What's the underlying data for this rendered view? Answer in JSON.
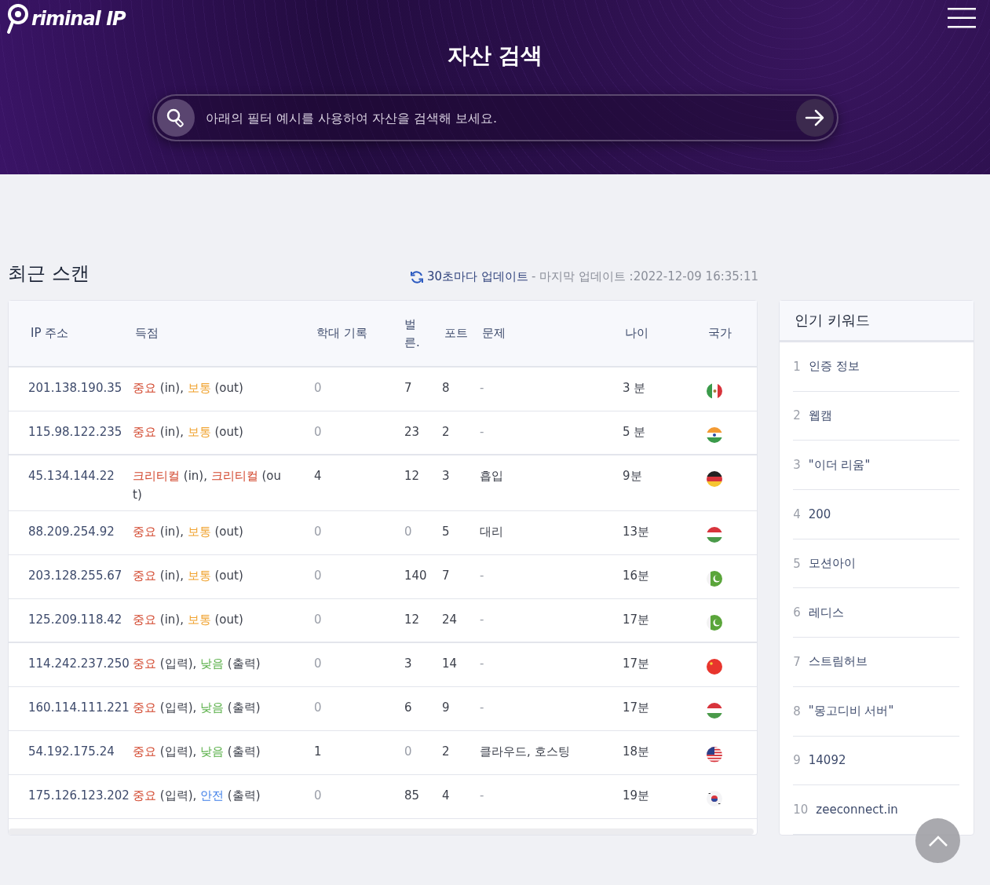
{
  "header": {
    "logo": "riminal IP",
    "title": "자산 검색",
    "search": {
      "placeholder": "아래의 필터 예시를 사용하여 자산을 검색해 보세요."
    }
  },
  "recent": {
    "title": "최근 스캔",
    "update_link": "30초마다 업데이트",
    "update_info": "- 마지막 업데이트 :2022-12-09 16:35:11",
    "columns": [
      "IP 주소",
      "득점",
      "학대 기록",
      "벌른.",
      "포트",
      "문제",
      "나이",
      "국가"
    ],
    "rows": [
      {
        "ip": "201.138.190.35",
        "score": [
          {
            "kind": "high",
            "level": "중요",
            "label": "(in),"
          },
          {
            "kind": "medium",
            "level": "보통",
            "label": "(out)"
          }
        ],
        "abuse": "0",
        "abuse_muted": true,
        "vuln": "7",
        "vuln_muted": false,
        "port": "8",
        "issue": "-",
        "issue_muted": true,
        "age": "3 분",
        "flag": {
          "kind": "mx"
        }
      },
      {
        "ip": "115.98.122.235",
        "score": [
          {
            "kind": "high",
            "level": "중요",
            "label": "(in),"
          },
          {
            "kind": "medium",
            "level": "보통",
            "label": "(out)"
          }
        ],
        "abuse": "0",
        "abuse_muted": true,
        "vuln": "23",
        "vuln_muted": false,
        "port": "2",
        "issue": "-",
        "issue_muted": true,
        "age": "5 분",
        "flag": {
          "kind": "in"
        }
      },
      {
        "ip": "45.134.144.22",
        "score": [
          {
            "kind": "critical",
            "level": "크리티컬",
            "label": "(in),"
          },
          {
            "kind": "critical",
            "level": "크리티컬",
            "label": "(out)"
          }
        ],
        "abuse": "4",
        "abuse_muted": false,
        "vuln": "12",
        "vuln_muted": false,
        "port": "3",
        "issue": "흡입",
        "issue_muted": false,
        "age": "9분",
        "flag": {
          "kind": "de"
        }
      },
      {
        "ip": "88.209.254.92",
        "score": [
          {
            "kind": "high",
            "level": "중요",
            "label": "(in),"
          },
          {
            "kind": "medium",
            "level": "보통",
            "label": "(out)"
          }
        ],
        "abuse": "0",
        "abuse_muted": true,
        "vuln": "0",
        "vuln_muted": true,
        "port": "5",
        "issue": "대리",
        "issue_muted": false,
        "age": "13분",
        "flag": {
          "kind": "hu"
        }
      },
      {
        "ip": "203.128.255.67",
        "score": [
          {
            "kind": "high",
            "level": "중요",
            "label": "(in),"
          },
          {
            "kind": "medium",
            "level": "보통",
            "label": "(out)"
          }
        ],
        "abuse": "0",
        "abuse_muted": true,
        "vuln": "140",
        "vuln_muted": false,
        "port": "7",
        "issue": "-",
        "issue_muted": true,
        "age": "16분",
        "flag": {
          "kind": "pk"
        }
      },
      {
        "ip": "125.209.118.42",
        "score": [
          {
            "kind": "high",
            "level": "중요",
            "label": "(in),"
          },
          {
            "kind": "medium",
            "level": "보통",
            "label": "(out)"
          }
        ],
        "abuse": "0",
        "abuse_muted": true,
        "vuln": "12",
        "vuln_muted": false,
        "port": "24",
        "issue": "-",
        "issue_muted": true,
        "age": "17분",
        "flag": {
          "kind": "pk"
        }
      },
      {
        "ip": "114.242.237.250",
        "score": [
          {
            "kind": "high",
            "level": "중요",
            "label": "(입력),"
          },
          {
            "kind": "low",
            "level": "낮음",
            "label": "(출력)"
          }
        ],
        "abuse": "0",
        "abuse_muted": true,
        "vuln": "3",
        "vuln_muted": false,
        "port": "14",
        "issue": "-",
        "issue_muted": true,
        "age": "17분",
        "flag": {
          "kind": "cn"
        }
      },
      {
        "ip": "160.114.111.221",
        "score": [
          {
            "kind": "high",
            "level": "중요",
            "label": "(입력),"
          },
          {
            "kind": "low",
            "level": "낮음",
            "label": "(출력)"
          }
        ],
        "abuse": "0",
        "abuse_muted": true,
        "vuln": "6",
        "vuln_muted": false,
        "port": "9",
        "issue": "-",
        "issue_muted": true,
        "age": "17분",
        "flag": {
          "kind": "hu"
        }
      },
      {
        "ip": "54.192.175.24",
        "score": [
          {
            "kind": "high",
            "level": "중요",
            "label": "(입력),"
          },
          {
            "kind": "low",
            "level": "낮음",
            "label": "(출력)"
          }
        ],
        "abuse": "1",
        "abuse_muted": false,
        "vuln": "0",
        "vuln_muted": true,
        "port": "2",
        "issue": "클라우드, 호스팅",
        "issue_muted": false,
        "age": "18분",
        "flag": {
          "kind": "us"
        }
      },
      {
        "ip": "175.126.123.202",
        "score": [
          {
            "kind": "high",
            "level": "중요",
            "label": "(입력),"
          },
          {
            "kind": "safe",
            "level": "안전",
            "label": "(출력)"
          }
        ],
        "abuse": "0",
        "abuse_muted": true,
        "vuln": "85",
        "vuln_muted": false,
        "port": "4",
        "issue": "-",
        "issue_muted": true,
        "age": "19분",
        "flag": {
          "kind": "kr"
        }
      }
    ]
  },
  "keywords": {
    "title": "인기 키워드",
    "items": [
      {
        "rank": "1",
        "text": "인증 정보"
      },
      {
        "rank": "2",
        "text": "웹캠"
      },
      {
        "rank": "3",
        "text": "\"이더 리움\""
      },
      {
        "rank": "4",
        "text": "200"
      },
      {
        "rank": "5",
        "text": "모션아이"
      },
      {
        "rank": "6",
        "text": "레디스"
      },
      {
        "rank": "7",
        "text": "스트림허브"
      },
      {
        "rank": "8",
        "text": "\"몽고디비 서버\""
      },
      {
        "rank": "9",
        "text": "14092"
      },
      {
        "rank": "10",
        "text": "zeeconnect.in"
      }
    ]
  }
}
